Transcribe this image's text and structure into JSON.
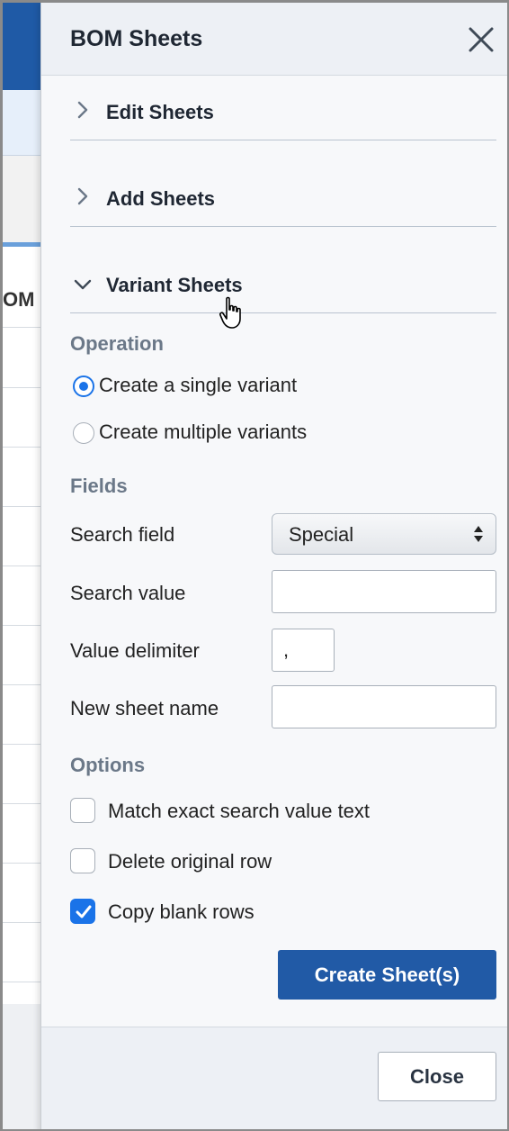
{
  "background_app": {
    "column_header_fragment": "OM",
    "colors": {
      "header_bar": "#1f5aa6",
      "subheader": "#e6effa",
      "accent": "#6aa0db"
    }
  },
  "panel": {
    "title": "BOM Sheets",
    "close_icon": "close-x-icon",
    "sections": [
      {
        "label": "Edit Sheets",
        "expanded": false,
        "icon": "chevron-right-icon"
      },
      {
        "label": "Add Sheets",
        "expanded": false,
        "icon": "chevron-right-icon"
      },
      {
        "label": "Variant Sheets",
        "expanded": true,
        "icon": "chevron-down-icon"
      }
    ],
    "operation": {
      "heading": "Operation",
      "options": [
        {
          "label": "Create a single variant",
          "selected": true
        },
        {
          "label": "Create multiple variants",
          "selected": false
        }
      ]
    },
    "fields": {
      "heading": "Fields",
      "search_field": {
        "label": "Search field",
        "value": "Special"
      },
      "search_value": {
        "label": "Search value",
        "value": ""
      },
      "value_delimiter": {
        "label": "Value delimiter",
        "value": ","
      },
      "new_sheet_name": {
        "label": "New sheet name",
        "value": ""
      }
    },
    "options": {
      "heading": "Options",
      "items": [
        {
          "label": "Match exact search value text",
          "checked": false
        },
        {
          "label": "Delete original row",
          "checked": false
        },
        {
          "label": "Copy blank rows",
          "checked": true
        }
      ]
    },
    "create_button": "Create Sheet(s)",
    "footer": {
      "close_button": "Close"
    },
    "colors": {
      "primary": "#215aa6",
      "radio_checkbox_accent": "#1a73e8",
      "subheading": "#6b7888"
    }
  }
}
